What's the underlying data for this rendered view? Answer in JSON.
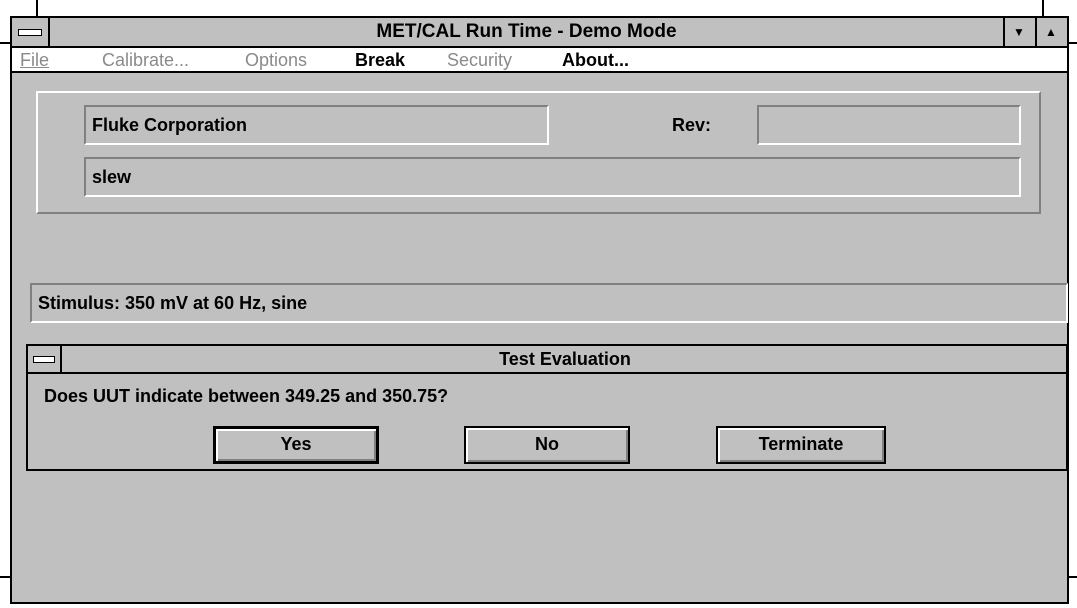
{
  "window": {
    "title": "MET/CAL Run Time - Demo Mode",
    "minimize_glyph": "▼",
    "maximize_glyph": "▲"
  },
  "menu": {
    "items": [
      {
        "label": "File",
        "enabled": false
      },
      {
        "label": "Calibrate...",
        "enabled": false
      },
      {
        "label": "Options",
        "enabled": false
      },
      {
        "label": "Break",
        "enabled": true
      },
      {
        "label": "Security",
        "enabled": false
      },
      {
        "label": "About...",
        "enabled": true
      }
    ]
  },
  "info": {
    "company": "Fluke Corporation",
    "rev_label": "Rev:",
    "rev_value": "",
    "procedure": "slew"
  },
  "stimulus": {
    "text": "Stimulus:  350 mV at 60 Hz, sine"
  },
  "evaluation": {
    "title": "Test Evaluation",
    "question": "Does UUT indicate between 349.25 and 350.75?",
    "buttons": {
      "yes": "Yes",
      "no": "No",
      "terminate": "Terminate"
    }
  },
  "colors": {
    "face": "#c0c0c0",
    "disabled_text": "#8a8a8a",
    "menu_bg": "#ffffff"
  }
}
